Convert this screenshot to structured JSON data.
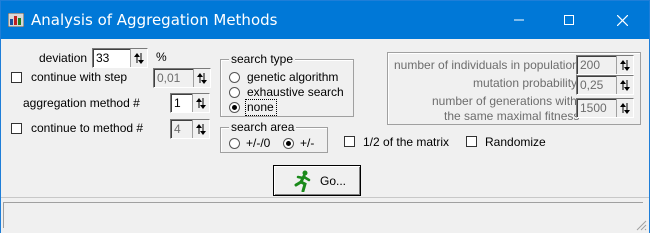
{
  "window": {
    "title": "Analysis of Aggregation Methods"
  },
  "controls": {
    "minimize_icon": "minimize-icon",
    "maximize_icon": "maximize-icon",
    "close_icon": "close-icon"
  },
  "params": {
    "deviation_label": "deviation",
    "deviation_value": "33",
    "deviation_unit": "%",
    "continue_step_label": "continue with step",
    "continue_step_checked": false,
    "step_value": "0,01",
    "aggregation_label": "aggregation method #",
    "aggregation_value": "1",
    "continue_method_label": "continue to method #",
    "continue_method_checked": false,
    "method_value": "4"
  },
  "search_type": {
    "title": "search type",
    "options": [
      "genetic algorithm",
      "exhaustive search",
      "none"
    ],
    "selected": "none"
  },
  "search_area": {
    "title": "search area",
    "options": [
      "+/-/0",
      "+/-"
    ],
    "selected": "+/-"
  },
  "genetic": {
    "population_label": "number of individuals in population",
    "population_value": "200",
    "mutation_label": "mutation probability",
    "mutation_value": "0,25",
    "generations_label_line1": "number of generations with",
    "generations_label_line2": "the same maximal fitness",
    "generations_value": "1500"
  },
  "options": {
    "half_matrix_label": "1/2 of the matrix",
    "half_matrix_checked": false,
    "randomize_label": "Randomize",
    "randomize_checked": false
  },
  "go_button": {
    "label": "Go...",
    "icon": "running-man-icon"
  },
  "colors": {
    "titlebar": "#0078d7",
    "face": "#f0f0f0"
  }
}
